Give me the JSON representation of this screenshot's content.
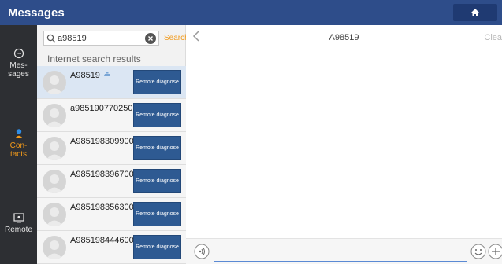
{
  "header": {
    "title": "Messages",
    "home_icon": "home-icon"
  },
  "nav": {
    "items": [
      {
        "label": "Mes-\nsages",
        "icon": "chat-bubble-icon",
        "active": false
      },
      {
        "label": "Con-\ntacts",
        "icon": "person-icon",
        "active": true
      },
      {
        "label": "Remote",
        "icon": "remote-screen-icon",
        "active": false
      }
    ]
  },
  "search": {
    "value": "a98519",
    "placeholder": "",
    "button_label": "Search"
  },
  "results": {
    "label": "Internet search results",
    "button_label": "Remote diagnose",
    "items": [
      {
        "name": "A98519",
        "selected": true
      },
      {
        "name": "a985190770250",
        "selected": false
      },
      {
        "name": "A985198309900",
        "selected": false
      },
      {
        "name": "A985198396700",
        "selected": false
      },
      {
        "name": "A985198356300",
        "selected": false
      },
      {
        "name": "A985198444600",
        "selected": false
      }
    ]
  },
  "chat": {
    "title": "A98519",
    "clear_label": "Clea",
    "input_value": ""
  },
  "colors": {
    "topbar": "#2e4d8a",
    "accent": "#f29a1a",
    "button": "#2e5a92",
    "selected_row": "#dbe6f3"
  }
}
